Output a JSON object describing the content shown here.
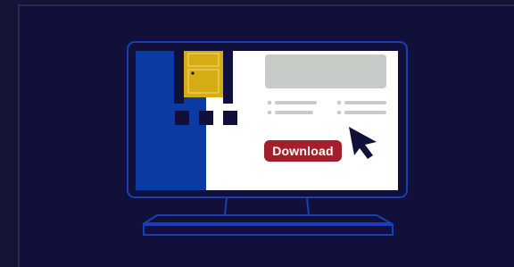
{
  "colors": {
    "background": "#151336",
    "panel": "#11103a",
    "outline": "#1a3fb5",
    "blue_block": "#0b3aa3",
    "door": "#d6ac14",
    "button": "#a31f2c",
    "placeholder": "#c8ccc8"
  },
  "icons": [
    "monitor-icon",
    "door-icon",
    "cursor-icon",
    "keyboard-icon"
  ],
  "button": {
    "label": "Download"
  }
}
